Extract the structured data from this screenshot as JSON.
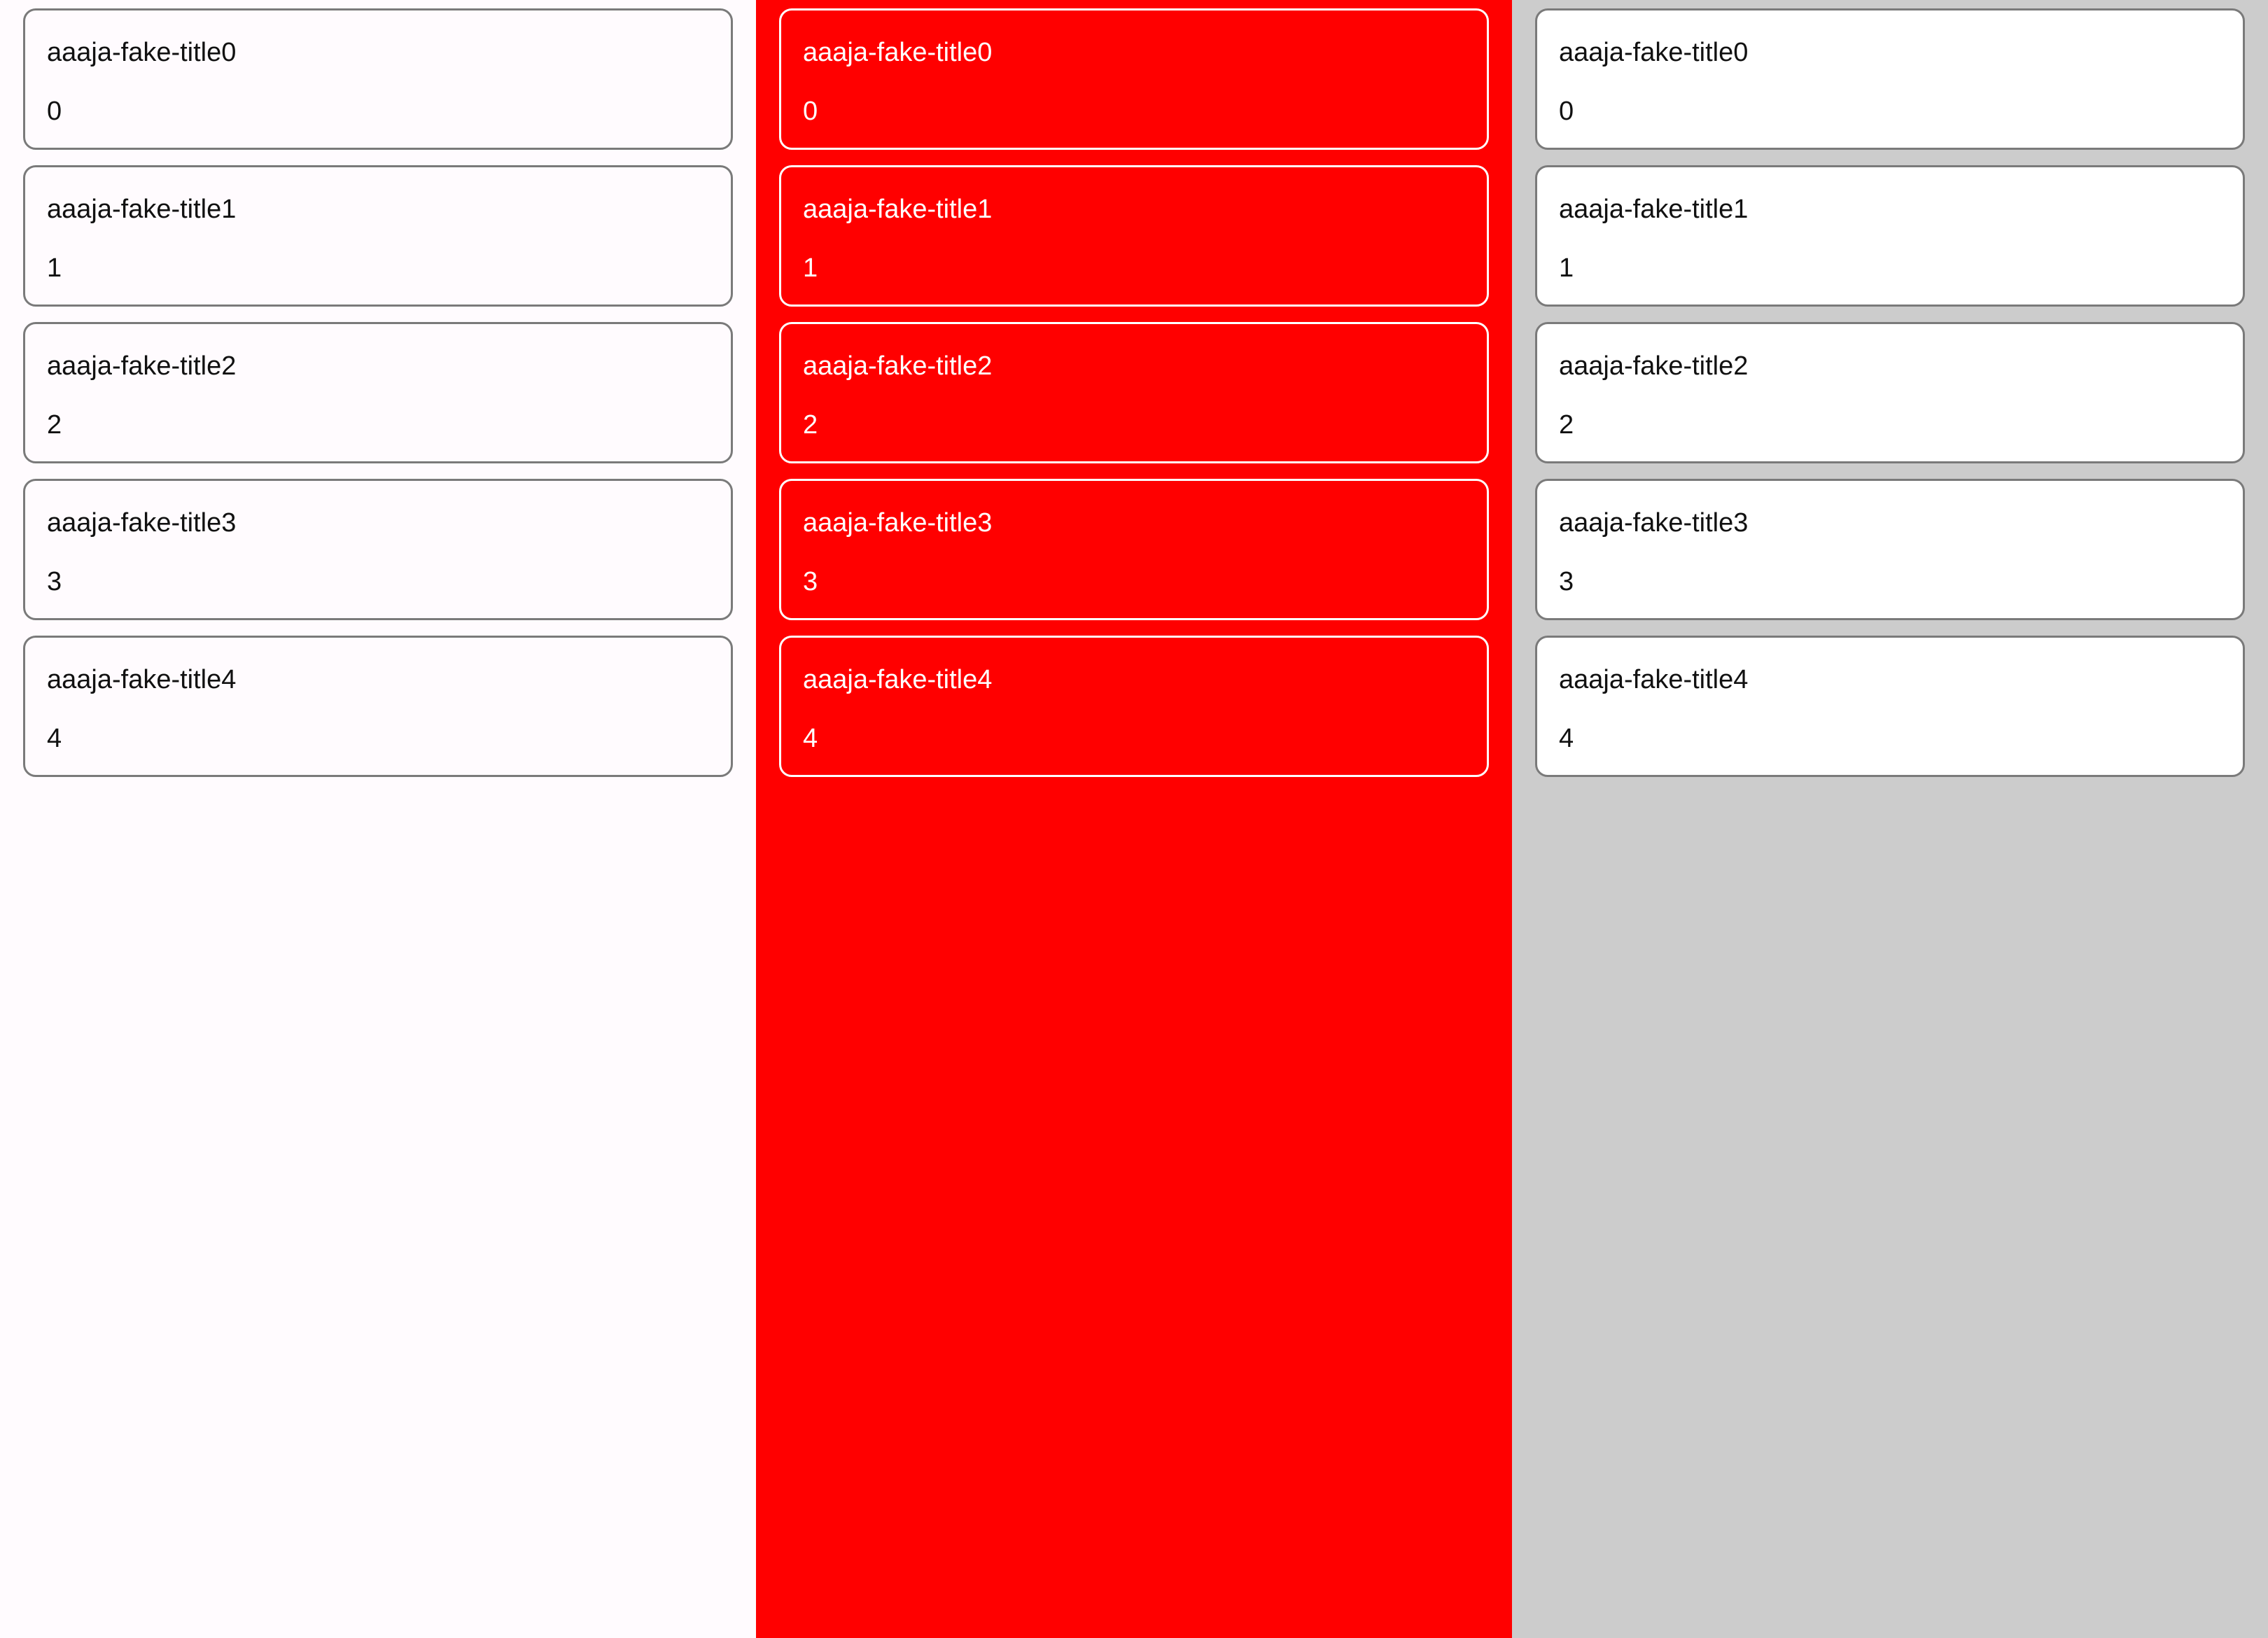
{
  "colors": {
    "left_background": "#fffbfe",
    "middle_background": "#ff0000",
    "right_background": "#cccccc",
    "card_border_gray": "#7a7a7a",
    "card_border_white": "#ffffff"
  },
  "columns": [
    {
      "cards": [
        {
          "title": "aaaja-fake-title0",
          "value": "0"
        },
        {
          "title": "aaaja-fake-title1",
          "value": "1"
        },
        {
          "title": "aaaja-fake-title2",
          "value": "2"
        },
        {
          "title": "aaaja-fake-title3",
          "value": "3"
        },
        {
          "title": "aaaja-fake-title4",
          "value": "4"
        }
      ]
    },
    {
      "cards": [
        {
          "title": "aaaja-fake-title0",
          "value": "0"
        },
        {
          "title": "aaaja-fake-title1",
          "value": "1"
        },
        {
          "title": "aaaja-fake-title2",
          "value": "2"
        },
        {
          "title": "aaaja-fake-title3",
          "value": "3"
        },
        {
          "title": "aaaja-fake-title4",
          "value": "4"
        }
      ]
    },
    {
      "cards": [
        {
          "title": "aaaja-fake-title0",
          "value": "0"
        },
        {
          "title": "aaaja-fake-title1",
          "value": "1"
        },
        {
          "title": "aaaja-fake-title2",
          "value": "2"
        },
        {
          "title": "aaaja-fake-title3",
          "value": "3"
        },
        {
          "title": "aaaja-fake-title4",
          "value": "4"
        }
      ]
    }
  ]
}
